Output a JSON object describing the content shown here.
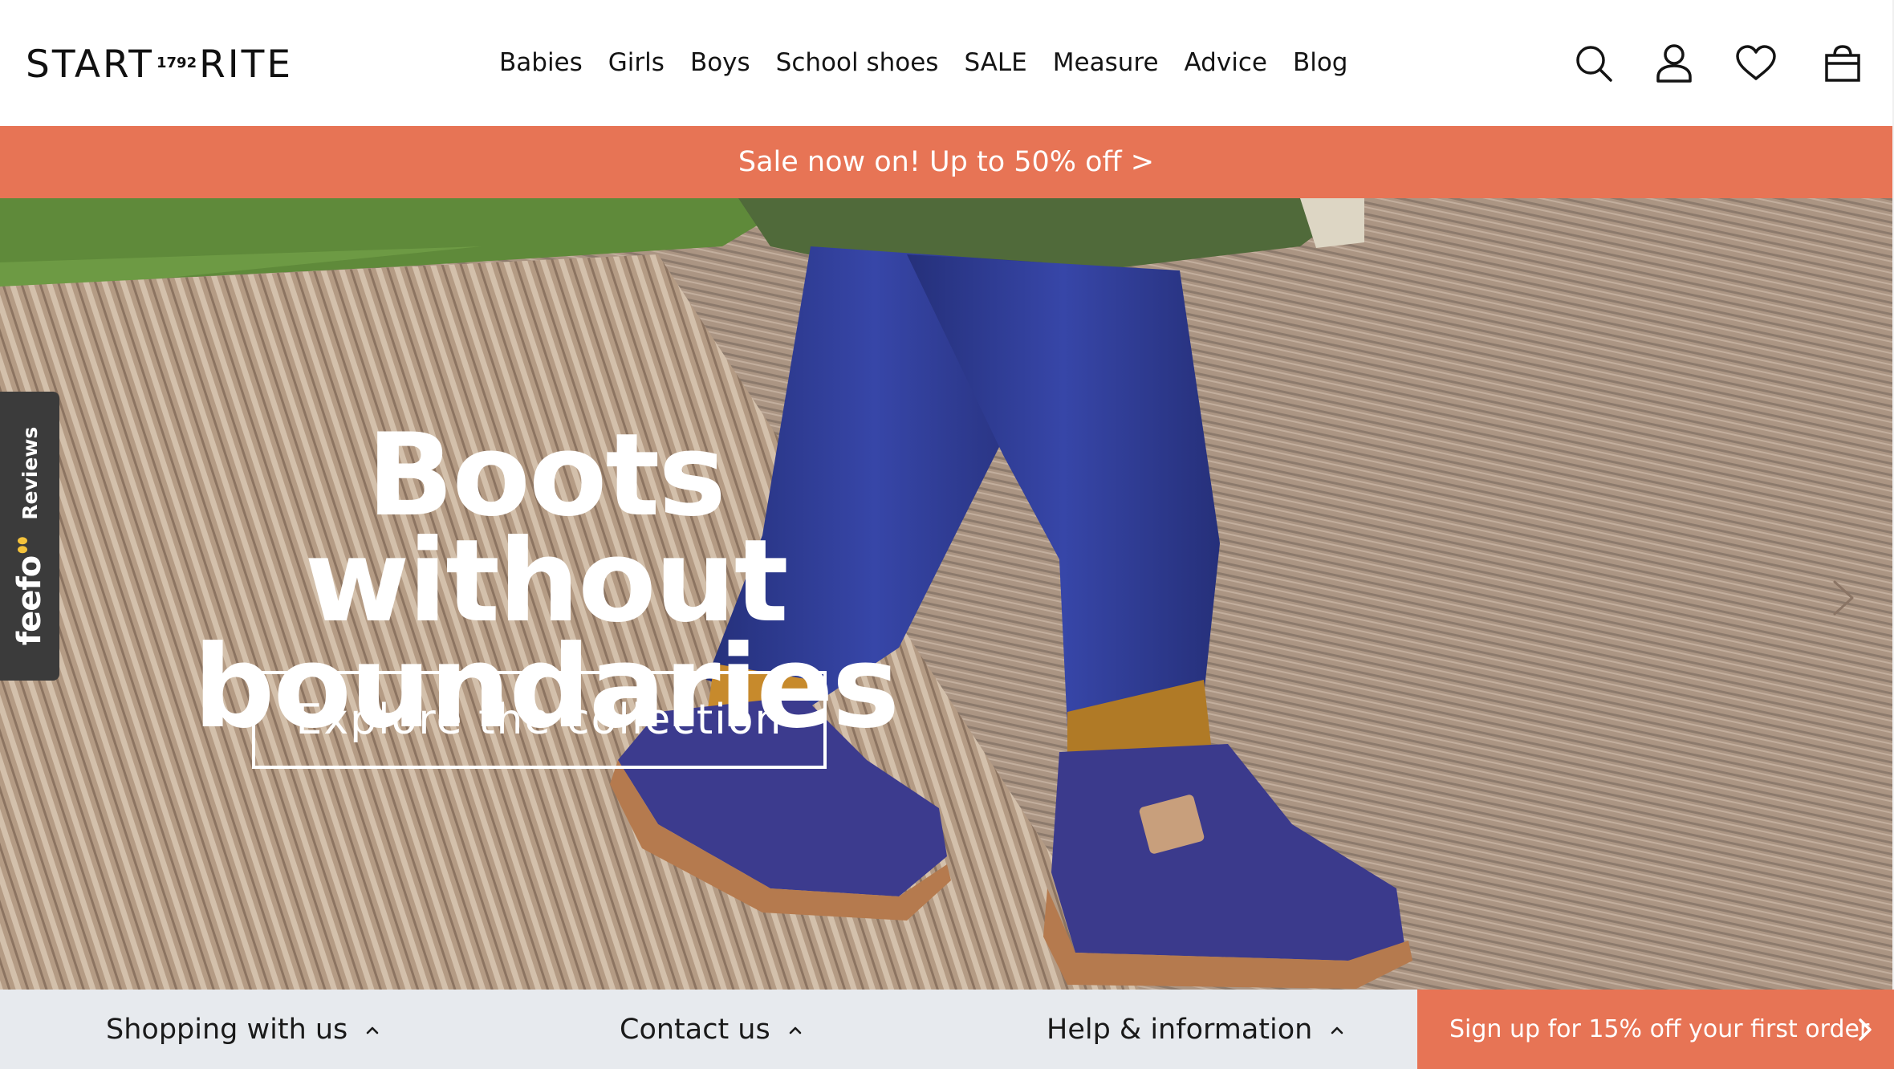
{
  "header": {
    "logo": {
      "left": "START",
      "year": "1792",
      "right": "RITE"
    },
    "nav": [
      "Babies",
      "Girls",
      "Boys",
      "School shoes",
      "SALE",
      "Measure",
      "Advice",
      "Blog"
    ],
    "icons": [
      "search-icon",
      "account-icon",
      "heart-icon",
      "bag-icon"
    ]
  },
  "promo": {
    "text": "Sale now on! Up to 50% off >"
  },
  "hero": {
    "heading_line1": "Boots without",
    "heading_line2": "boundaries",
    "cta": "Explore the collection",
    "next_icon": "chevron-right-icon"
  },
  "feefo": {
    "brand": "feefo",
    "label": "Reviews"
  },
  "footer": {
    "items": [
      "Shopping with us",
      "Contact us",
      "Help & information"
    ],
    "signup": "Sign up for 15% off your first order"
  },
  "colors": {
    "accent": "#e77455",
    "footer_bg": "#e7eaee",
    "text": "#141414"
  }
}
